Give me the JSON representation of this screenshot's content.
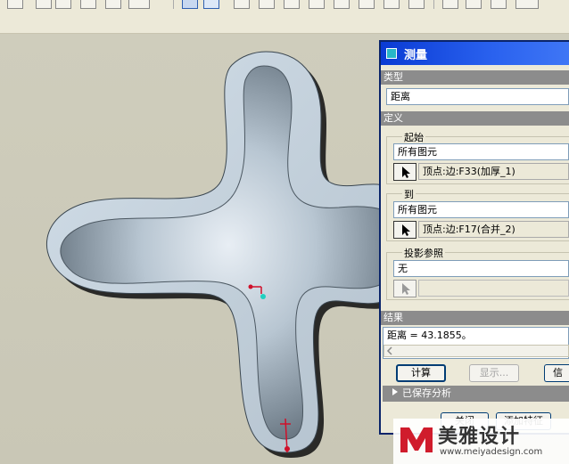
{
  "dialog": {
    "title": "测量",
    "type_section": "类型",
    "type_value": "距离",
    "definition_section": "定义",
    "from": {
      "label": "起始",
      "filter": "所有图元",
      "selection": "顶点:边:F33(加厚_1)"
    },
    "to": {
      "label": "到",
      "filter": "所有图元",
      "selection": "顶点:边:F17(合并_2)"
    },
    "projection": {
      "label": "投影参照",
      "filter": "无",
      "selection": ""
    },
    "result_section": "结果",
    "result_text": "距离 = 43.1855。",
    "compute_button": "计算",
    "show_button": "显示...",
    "info_button": "信",
    "saved_analysis": "已保存分析",
    "close_button": "关闭",
    "add_feature_button": "添加特征"
  },
  "watermark": {
    "brand": "美雅设计",
    "url": "www.meiyadesign.com"
  }
}
